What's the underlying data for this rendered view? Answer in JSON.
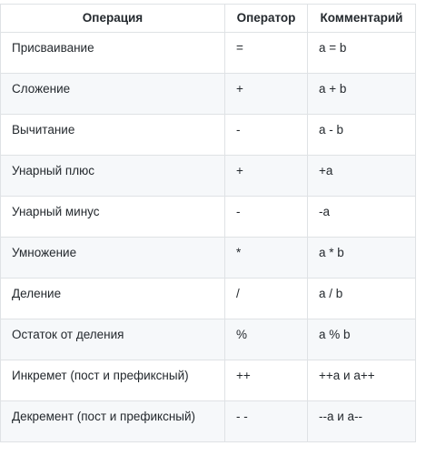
{
  "table": {
    "headers": [
      "Операция",
      "Оператор",
      "Комментарий"
    ],
    "rows": [
      [
        "Присваивание",
        "=",
        "a = b"
      ],
      [
        "Сложение",
        "+",
        "a + b"
      ],
      [
        "Вычитание",
        "-",
        "a - b"
      ],
      [
        "Унарный плюс",
        "+",
        "+a"
      ],
      [
        "Унарный минус",
        "-",
        "-a"
      ],
      [
        "Умножение",
        "*",
        "a * b"
      ],
      [
        "Деление",
        "/",
        "a / b"
      ],
      [
        "Остаток от деления",
        "%",
        "a % b"
      ],
      [
        "Инкремет (пост и префиксный)",
        "++",
        "++a и a++"
      ],
      [
        "Декремент (пост и префиксный)",
        "- -",
        "--a и a--"
      ]
    ]
  }
}
